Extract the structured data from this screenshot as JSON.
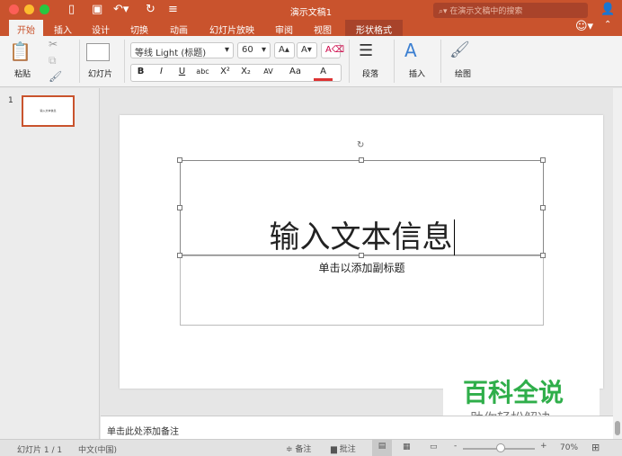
{
  "window": {
    "title": "演示文稿1",
    "search_placeholder": "在演示文稿中的搜索"
  },
  "tabs": [
    "开始",
    "插入",
    "设计",
    "切换",
    "动画",
    "幻灯片放映",
    "审阅",
    "视图",
    "形状格式"
  ],
  "ribbon": {
    "paste": "粘贴",
    "slide": "幻灯片",
    "font": "等线 Light (标题)",
    "size": "60",
    "paragraph": "段落",
    "insert": "插入",
    "draw": "绘图",
    "fmt": [
      "B",
      "I",
      "U",
      "abc",
      "X²",
      "X₂",
      "AV",
      "Aa",
      "A"
    ],
    "grow": "A▴",
    "shrink": "A▾"
  },
  "thumbs": [
    {
      "num": "1",
      "text": "输入文本信息"
    }
  ],
  "slide": {
    "title": "输入文本信息",
    "subtitle": "单击以添加副标题"
  },
  "notes": {
    "placeholder": "单击此处添加备注"
  },
  "status": {
    "slide": "幻灯片 1 / 1",
    "lang": "中文(中国)",
    "notes": "备注",
    "comments": "批注",
    "zoom": "70%",
    "zoom_value": 70
  },
  "watermark": {
    "line1": "百科全说",
    "line2": "助你轻松解决"
  },
  "colors": {
    "accent": "#c9532d"
  }
}
